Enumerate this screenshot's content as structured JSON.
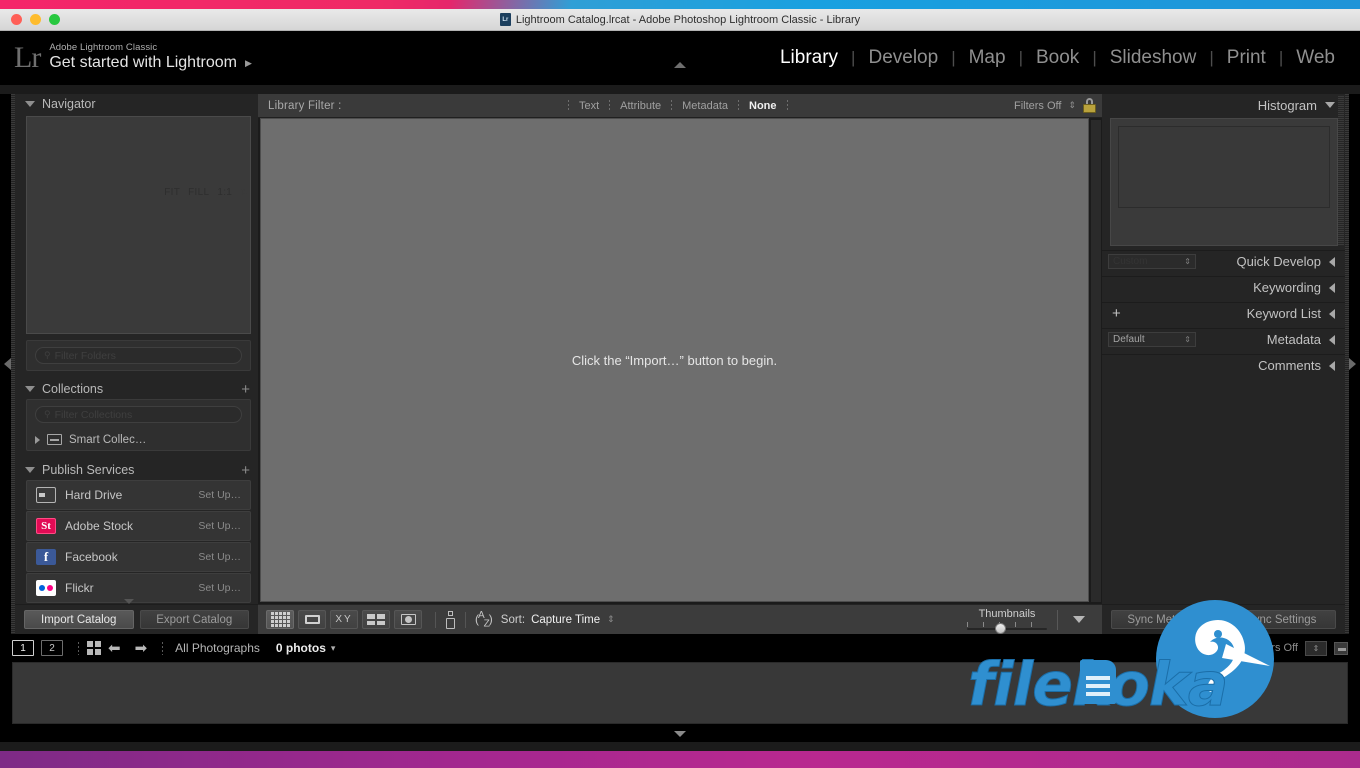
{
  "window": {
    "title": "Lightroom Catalog.lrcat - Adobe Photoshop Lightroom Classic - Library",
    "doc_icon_label": "Lr",
    "traffic_lights": [
      "close",
      "minimize",
      "zoom"
    ]
  },
  "identity": {
    "logo": "Lr",
    "small_line": "Adobe Lightroom Classic",
    "big_line": "Get started with Lightroom",
    "arrow": "▶"
  },
  "modules": [
    {
      "label": "Library",
      "active": true
    },
    {
      "label": "Develop",
      "active": false
    },
    {
      "label": "Map",
      "active": false
    },
    {
      "label": "Book",
      "active": false
    },
    {
      "label": "Slideshow",
      "active": false
    },
    {
      "label": "Print",
      "active": false
    },
    {
      "label": "Web",
      "active": false
    }
  ],
  "module_separator": "|",
  "left_panel": {
    "navigator": {
      "title": "Navigator",
      "zoom_levels": [
        "FIT",
        "FILL",
        "1:1"
      ],
      "stepper": "⇅"
    },
    "folders": {
      "filter_placeholder": "Filter Folders",
      "search_icon": "search-icon"
    },
    "collections": {
      "title": "Collections",
      "add_label": "+",
      "filter_placeholder": "Filter Collections",
      "items": [
        {
          "label": "Smart Collec…",
          "icon": "collection-set-icon"
        }
      ]
    },
    "publish_services": {
      "title": "Publish Services",
      "add_label": "+",
      "items": [
        {
          "name": "Hard Drive",
          "action": "Set Up…",
          "icon": "hard-drive-icon"
        },
        {
          "name": "Adobe Stock",
          "action": "Set Up…",
          "icon": "adobe-stock-icon",
          "icon_text": "St",
          "color": "#e20b55"
        },
        {
          "name": "Facebook",
          "action": "Set Up…",
          "icon": "facebook-icon",
          "icon_text": "f",
          "color": "#3b5998"
        },
        {
          "name": "Flickr",
          "action": "Set Up…",
          "icon": "flickr-icon",
          "color": "#0063dc"
        }
      ]
    },
    "buttons": {
      "import_catalog": "Import Catalog",
      "export_catalog": "Export Catalog"
    }
  },
  "library_filter": {
    "label": "Library Filter :",
    "tabs": [
      {
        "label": "Text",
        "active": false
      },
      {
        "label": "Attribute",
        "active": false
      },
      {
        "label": "Metadata",
        "active": false
      },
      {
        "label": "None",
        "active": true
      }
    ],
    "filters_state": "Filters Off",
    "lock_icon": "lock-icon"
  },
  "content": {
    "message": "Click the “Import…” button to begin."
  },
  "toolbar": {
    "view_modes": [
      {
        "name": "grid-view",
        "active": true
      },
      {
        "name": "loupe-view",
        "active": false
      },
      {
        "name": "compare-view",
        "active": false
      },
      {
        "name": "survey-view",
        "active": false
      },
      {
        "name": "people-view",
        "active": false
      }
    ],
    "painter": "spray-can-icon",
    "sort_icon": "az-sort-icon",
    "sort_label": "Sort:",
    "sort_value": "Capture Time",
    "sort_stepper": "⇅",
    "thumbnails_label": "Thumbnails",
    "thumbnails_value": 35
  },
  "right_panel": {
    "histogram": {
      "title": "Histogram",
      "collapse": "▼"
    },
    "sections": [
      {
        "title": "Quick Develop",
        "collapse": "◀",
        "select_value": "Custom",
        "has_select": true,
        "dim": true
      },
      {
        "title": "Keywording",
        "collapse": "◀",
        "has_select": false
      },
      {
        "title": "Keyword List",
        "collapse": "◀",
        "has_select": false,
        "add": "+"
      },
      {
        "title": "Metadata",
        "collapse": "◀",
        "select_value": "Default",
        "has_select": true,
        "dim": false
      },
      {
        "title": "Comments",
        "collapse": "◀",
        "has_select": false
      }
    ],
    "buttons": {
      "sync_metadata": "Sync Metadata",
      "sync_settings": "Sync Settings"
    }
  },
  "filmstrip": {
    "pages": [
      "1",
      "2"
    ],
    "grid_icon": "grid-icon",
    "back_icon": "arrow-left-icon",
    "forward_icon": "arrow-right-icon",
    "source_label": "All Photographs",
    "photo_count": "0 photos",
    "count_caret": "▾",
    "filter_label": "Filter :",
    "filter_value": "Filters Off"
  },
  "watermark": {
    "text": "filekoka",
    "color": "#2f8fd0"
  },
  "colors": {
    "panel_bg": "#252525",
    "content_bg": "#6e6e6e",
    "accent_yellow": "#b9a23c",
    "adobe_stock": "#e20b55",
    "facebook": "#3b5998"
  }
}
